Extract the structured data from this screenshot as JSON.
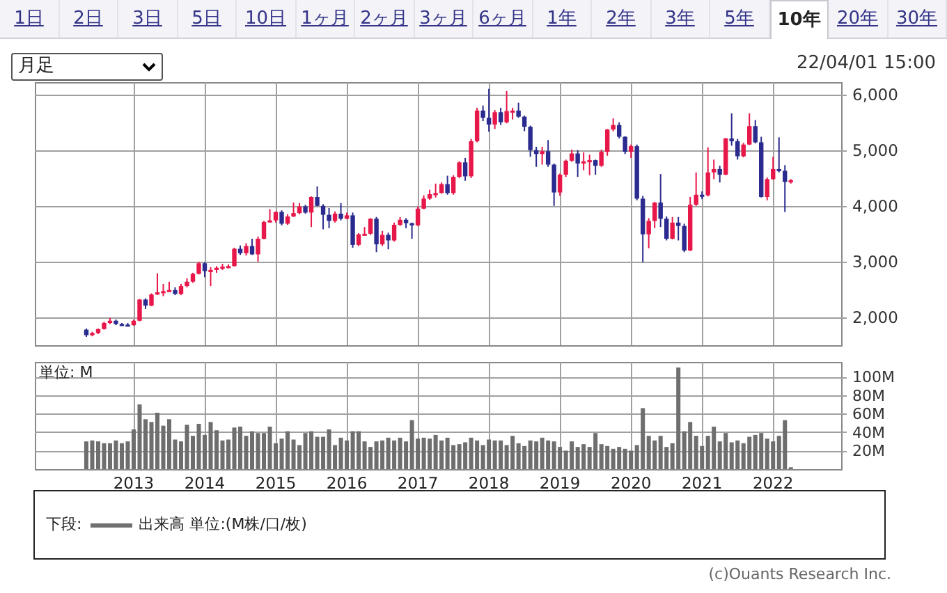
{
  "tabs": [
    {
      "label": "1日",
      "selected": false
    },
    {
      "label": "2日",
      "selected": false
    },
    {
      "label": "3日",
      "selected": false
    },
    {
      "label": "5日",
      "selected": false
    },
    {
      "label": "10日",
      "selected": false
    },
    {
      "label": "1ヶ月",
      "selected": false
    },
    {
      "label": "2ヶ月",
      "selected": false
    },
    {
      "label": "3ヶ月",
      "selected": false
    },
    {
      "label": "6ヶ月",
      "selected": false
    },
    {
      "label": "1年",
      "selected": false
    },
    {
      "label": "2年",
      "selected": false
    },
    {
      "label": "3年",
      "selected": false
    },
    {
      "label": "5年",
      "selected": false
    },
    {
      "label": "10年",
      "selected": true
    },
    {
      "label": "20年",
      "selected": false
    },
    {
      "label": "30年",
      "selected": false
    }
  ],
  "period_select": {
    "value": "月足"
  },
  "timestamp": "22/04/01 15:00",
  "price_chart": {
    "chart_data": {
      "type": "candlestick",
      "grid": true,
      "ylim": [
        1500,
        6220
      ],
      "yticks": [
        {
          "value": 2000,
          "label": "2,000"
        },
        {
          "value": 3000,
          "label": "3,000"
        },
        {
          "value": 4000,
          "label": "4,000"
        },
        {
          "value": 5000,
          "label": "5,000"
        },
        {
          "value": 6000,
          "label": "6,000"
        }
      ],
      "categories": [
        null,
        null,
        null,
        null,
        null,
        null,
        null,
        null,
        null,
        null,
        null,
        null,
        null,
        null,
        null,
        null,
        null,
        null,
        null,
        null,
        null,
        null,
        null,
        null,
        null,
        null,
        null,
        null,
        null,
        null,
        null,
        null,
        null,
        null,
        null,
        null,
        null,
        null,
        null,
        null,
        null,
        null,
        null,
        null,
        null,
        null,
        null,
        null,
        null,
        null,
        null,
        null,
        null,
        null,
        null,
        null,
        null,
        null,
        null,
        null,
        null,
        null,
        null,
        null,
        null,
        null,
        null,
        null,
        null,
        null,
        null,
        null,
        null,
        null,
        null,
        null,
        null,
        null,
        null,
        null,
        null,
        null,
        null,
        null,
        null,
        null,
        null,
        null,
        null,
        null,
        null,
        null,
        null,
        null,
        null,
        null,
        null,
        null,
        null,
        null,
        null,
        null,
        null,
        null,
        null,
        null,
        null,
        null,
        null,
        null,
        null,
        null,
        null,
        null,
        null,
        null,
        null,
        null,
        null,
        null
      ],
      "ohlc": [
        [
          1780,
          1800,
          1650,
          1680
        ],
        [
          1680,
          1740,
          1660,
          1720
        ],
        [
          1720,
          1800,
          1700,
          1790
        ],
        [
          1790,
          1920,
          1780,
          1900
        ],
        [
          1900,
          1990,
          1880,
          1940
        ],
        [
          1940,
          1960,
          1860,
          1880
        ],
        [
          1880,
          1900,
          1850,
          1870
        ],
        [
          1870,
          1900,
          1840,
          1860
        ],
        [
          1860,
          1960,
          1850,
          1940
        ],
        [
          1940,
          2330,
          1930,
          2320
        ],
        [
          2320,
          2340,
          2150,
          2210
        ],
        [
          2210,
          2430,
          2200,
          2410
        ],
        [
          2410,
          2790,
          2400,
          2450
        ],
        [
          2450,
          2600,
          2380,
          2470
        ],
        [
          2470,
          2640,
          2460,
          2490
        ],
        [
          2490,
          2540,
          2400,
          2420
        ],
        [
          2420,
          2600,
          2400,
          2560
        ],
        [
          2560,
          2700,
          2540,
          2640
        ],
        [
          2640,
          2800,
          2620,
          2780
        ],
        [
          2780,
          3000,
          2770,
          2970
        ],
        [
          2970,
          2990,
          2720,
          2830
        ],
        [
          2830,
          2900,
          2560,
          2850
        ],
        [
          2850,
          2920,
          2800,
          2890
        ],
        [
          2890,
          2960,
          2850,
          2910
        ],
        [
          2910,
          2950,
          2880,
          2920
        ],
        [
          2920,
          3250,
          2910,
          3230
        ],
        [
          3230,
          3290,
          3120,
          3150
        ],
        [
          3150,
          3330,
          3110,
          3280
        ],
        [
          3280,
          3410,
          3120,
          3130
        ],
        [
          3130,
          3450,
          3000,
          3410
        ],
        [
          3410,
          3730,
          3400,
          3710
        ],
        [
          3710,
          3940,
          3700,
          3740
        ],
        [
          3740,
          3900,
          3700,
          3890
        ],
        [
          3890,
          3920,
          3650,
          3680
        ],
        [
          3680,
          3850,
          3660,
          3810
        ],
        [
          3810,
          4060,
          3800,
          3870
        ],
        [
          3870,
          4050,
          3850,
          3990
        ],
        [
          3990,
          4020,
          3860,
          3880
        ],
        [
          3880,
          4170,
          3620,
          4160
        ],
        [
          4160,
          4350,
          3990,
          4000
        ],
        [
          4000,
          4030,
          3580,
          3840
        ],
        [
          3840,
          3960,
          3600,
          3730
        ],
        [
          3730,
          3900,
          3700,
          3860
        ],
        [
          3860,
          4050,
          3740,
          3770
        ],
        [
          3770,
          3880,
          3760,
          3830
        ],
        [
          3830,
          3880,
          3250,
          3300
        ],
        [
          3300,
          3510,
          3280,
          3490
        ],
        [
          3490,
          3620,
          3470,
          3500
        ],
        [
          3500,
          3780,
          3480,
          3770
        ],
        [
          3770,
          3800,
          3170,
          3310
        ],
        [
          3310,
          3550,
          3280,
          3480
        ],
        [
          3480,
          3520,
          3220,
          3380
        ],
        [
          3380,
          3700,
          3360,
          3660
        ],
        [
          3660,
          3800,
          3640,
          3750
        ],
        [
          3750,
          3780,
          3600,
          3690
        ],
        [
          3690,
          3700,
          3410,
          3650
        ],
        [
          3650,
          3990,
          3640,
          3950
        ],
        [
          3950,
          4190,
          3940,
          4130
        ],
        [
          4130,
          4290,
          4110,
          4210
        ],
        [
          4210,
          4400,
          4150,
          4230
        ],
        [
          4230,
          4420,
          4220,
          4390
        ],
        [
          4390,
          4540,
          4200,
          4230
        ],
        [
          4230,
          4550,
          4200,
          4520
        ],
        [
          4520,
          4800,
          4500,
          4780
        ],
        [
          4780,
          4860,
          4450,
          4530
        ],
        [
          4530,
          5200,
          4500,
          5160
        ],
        [
          5160,
          5760,
          5140,
          5710
        ],
        [
          5710,
          5800,
          5520,
          5580
        ],
        [
          5580,
          6100,
          5330,
          5460
        ],
        [
          5460,
          5720,
          5380,
          5680
        ],
        [
          5680,
          5760,
          5450,
          5500
        ],
        [
          5500,
          6060,
          5480,
          5700
        ],
        [
          5700,
          5760,
          5550,
          5710
        ],
        [
          5710,
          5850,
          5580,
          5600
        ],
        [
          5600,
          5620,
          5340,
          5420
        ],
        [
          5420,
          5440,
          4880,
          5000
        ],
        [
          5000,
          5060,
          4700,
          4930
        ],
        [
          4930,
          5060,
          4740,
          4980
        ],
        [
          4980,
          5180,
          4700,
          4740
        ],
        [
          4740,
          4760,
          4000,
          4240
        ],
        [
          4240,
          4580,
          4180,
          4560
        ],
        [
          4560,
          4830,
          4520,
          4810
        ],
        [
          4810,
          5010,
          4790,
          4940
        ],
        [
          4940,
          5000,
          4520,
          4760
        ],
        [
          4760,
          4960,
          4640,
          4800
        ],
        [
          4800,
          4920,
          4550,
          4820
        ],
        [
          4820,
          4830,
          4560,
          4720
        ],
        [
          4720,
          5010,
          4700,
          4970
        ],
        [
          4970,
          5380,
          4900,
          5370
        ],
        [
          5370,
          5570,
          5340,
          5450
        ],
        [
          5450,
          5500,
          5210,
          5240
        ],
        [
          5240,
          5250,
          4930,
          4970
        ],
        [
          4970,
          5100,
          4860,
          5070
        ],
        [
          5070,
          5100,
          4100,
          4130
        ],
        [
          4130,
          4180,
          2990,
          3490
        ],
        [
          3490,
          3780,
          3240,
          3730
        ],
        [
          3730,
          4070,
          3600,
          4060
        ],
        [
          4060,
          4570,
          3620,
          3770
        ],
        [
          3770,
          3810,
          3380,
          3410
        ],
        [
          3410,
          3800,
          3400,
          3700
        ],
        [
          3700,
          3800,
          3380,
          3640
        ],
        [
          3640,
          3680,
          3170,
          3200
        ],
        [
          3200,
          4160,
          3190,
          4020
        ],
        [
          4020,
          4600,
          4000,
          4200
        ],
        [
          4200,
          4260,
          4120,
          4190
        ],
        [
          4190,
          5050,
          4170,
          4600
        ],
        [
          4600,
          4830,
          4480,
          4660
        ],
        [
          4660,
          4720,
          4420,
          4560
        ],
        [
          4560,
          5220,
          4550,
          5210
        ],
        [
          5210,
          5660,
          5080,
          5160
        ],
        [
          5160,
          5200,
          4830,
          4890
        ],
        [
          4890,
          5130,
          4870,
          5100
        ],
        [
          5100,
          5660,
          5090,
          5430
        ],
        [
          5430,
          5540,
          5120,
          5140
        ],
        [
          5140,
          5240,
          4150,
          4160
        ],
        [
          4160,
          4510,
          4100,
          4480
        ],
        [
          4480,
          4880,
          4470,
          4660
        ],
        [
          4660,
          5230,
          4600,
          4630
        ],
        [
          4630,
          4730,
          3890,
          4430
        ],
        [
          4430,
          4480,
          4400,
          4460
        ]
      ]
    }
  },
  "volume_chart": {
    "unit_label": "単位: M",
    "chart_data": {
      "type": "bar",
      "grid": true,
      "ylim": [
        0,
        116
      ],
      "yticks": [
        {
          "value": 20,
          "label": "20M"
        },
        {
          "value": 40,
          "label": "40M"
        },
        {
          "value": 60,
          "label": "60M"
        },
        {
          "value": 80,
          "label": "80M"
        },
        {
          "value": 100,
          "label": "100M"
        }
      ],
      "categories": [
        null,
        null,
        null,
        null,
        null,
        null,
        null,
        null,
        "2013",
        null,
        null,
        null,
        null,
        null,
        null,
        null,
        null,
        null,
        null,
        null,
        "2014",
        null,
        null,
        null,
        null,
        null,
        null,
        null,
        null,
        null,
        null,
        null,
        "2015",
        null,
        null,
        null,
        null,
        null,
        null,
        null,
        null,
        null,
        null,
        null,
        "2016",
        null,
        null,
        null,
        null,
        null,
        null,
        null,
        null,
        null,
        null,
        null,
        "2017",
        null,
        null,
        null,
        null,
        null,
        null,
        null,
        null,
        null,
        null,
        null,
        "2018",
        null,
        null,
        null,
        null,
        null,
        null,
        null,
        null,
        null,
        null,
        null,
        "2019",
        null,
        null,
        null,
        null,
        null,
        null,
        null,
        null,
        null,
        null,
        null,
        "2020",
        null,
        null,
        null,
        null,
        null,
        null,
        null,
        null,
        null,
        null,
        null,
        "2021",
        null,
        null,
        null,
        null,
        null,
        null,
        null,
        null,
        null,
        null,
        null,
        "2022",
        null,
        null,
        null
      ],
      "values": [
        30,
        31,
        30,
        28,
        28,
        31,
        28,
        30,
        43,
        70,
        54,
        51,
        61,
        47,
        54,
        32,
        30,
        48,
        36,
        49,
        37,
        51,
        42,
        31,
        32,
        45,
        46,
        36,
        41,
        39,
        39,
        46,
        28,
        33,
        41,
        32,
        26,
        39,
        41,
        35,
        35,
        43,
        26,
        34,
        31,
        41,
        41,
        30,
        24,
        30,
        31,
        34,
        31,
        34,
        30,
        53,
        33,
        34,
        33,
        37,
        31,
        34,
        26,
        27,
        29,
        34,
        31,
        26,
        32,
        31,
        31,
        26,
        36,
        28,
        25,
        31,
        30,
        34,
        31,
        30,
        24,
        20,
        30,
        24,
        27,
        24,
        39,
        27,
        25,
        22,
        24,
        22,
        20,
        26,
        66,
        36,
        31,
        36,
        24,
        28,
        110,
        41,
        51,
        36,
        25,
        36,
        46,
        30,
        39,
        29,
        31,
        28,
        35,
        37,
        39,
        33,
        30,
        36,
        53,
        2
      ]
    }
  },
  "legend": {
    "prefix": "下段:",
    "items": [
      {
        "label": "出来高 単位:(M株/口/枚)"
      }
    ]
  },
  "copyright": "(c)Ouants Research Inc."
}
